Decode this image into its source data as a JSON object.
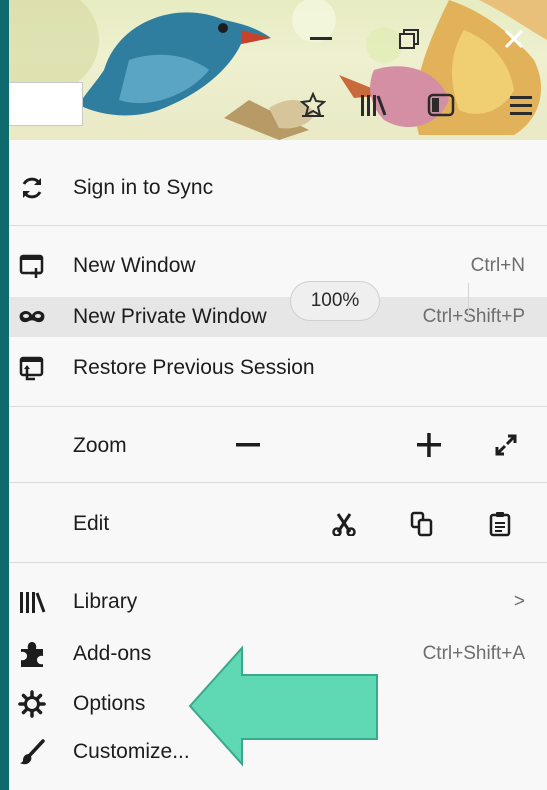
{
  "toolbar": {
    "icons": [
      "minimize-icon",
      "restore-icon",
      "close-icon",
      "bookmark-star-icon",
      "library-icon",
      "sidebar-icon",
      "hamburger-menu-icon"
    ]
  },
  "menu": {
    "sign_in": "Sign in to Sync",
    "new_window": {
      "label": "New Window",
      "shortcut": "Ctrl+N"
    },
    "new_private_window": {
      "label": "New Private Window",
      "shortcut": "Ctrl+Shift+P"
    },
    "restore_session": "Restore Previous Session",
    "zoom": {
      "label": "Zoom",
      "level": "100%",
      "minus": "—",
      "plus": "+"
    },
    "edit": {
      "label": "Edit"
    },
    "library": {
      "label": "Library",
      "chevron": ">"
    },
    "addons": {
      "label": "Add-ons",
      "shortcut": "Ctrl+Shift+A"
    },
    "options": "Options",
    "customize": "Customize..."
  },
  "colors": {
    "frame": "#0e6a6c",
    "menu_bg": "#f8f8f8",
    "highlight": "#e6e6e6",
    "arrow_fill": "#5fd8b4"
  }
}
